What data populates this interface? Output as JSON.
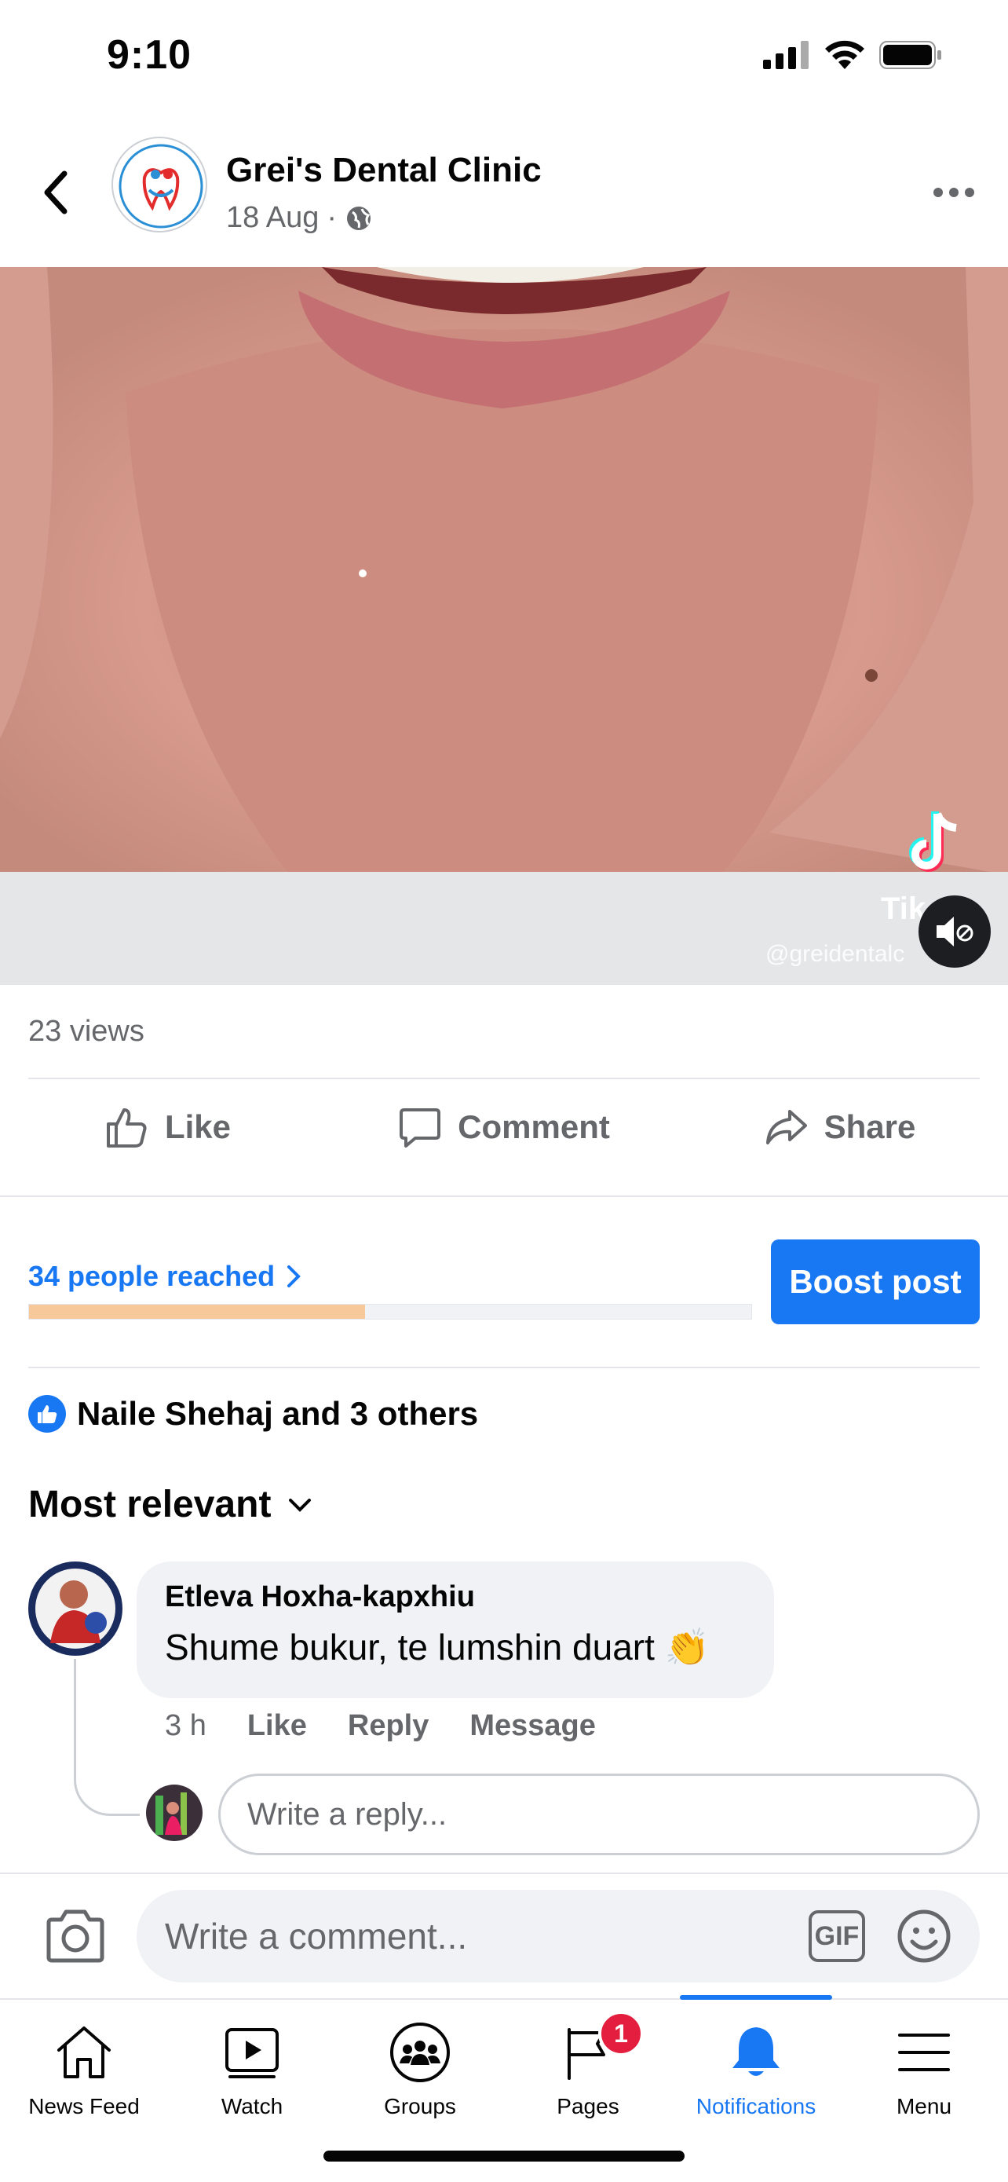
{
  "status_bar": {
    "time": "9:10"
  },
  "post": {
    "page_name": "Grei's Dental Clinic",
    "date": "18 Aug",
    "date_separator": "·",
    "video": {
      "watermark_text": "Tik",
      "watermark_handle": "@greidentalc"
    },
    "views": "23 views",
    "actions": {
      "like": "Like",
      "comment": "Comment",
      "share": "Share"
    },
    "reach": {
      "label": "34 people reached",
      "progress_percent": 46.5
    },
    "boost_label": "Boost post",
    "reactions_summary": "Naile Shehaj and 3 others"
  },
  "comments": {
    "sort_label": "Most relevant",
    "items": [
      {
        "author": "Etleva Hoxha-kapxhiu",
        "text": "Shume bukur, te lumshin duart 👏",
        "time": "3 h",
        "like": "Like",
        "reply": "Reply",
        "message": "Message"
      }
    ],
    "reply_placeholder": "Write a reply...",
    "comment_placeholder": "Write a comment...",
    "gif_label": "GIF"
  },
  "tabbar": {
    "tabs": [
      {
        "label": "News Feed",
        "icon": "home-icon"
      },
      {
        "label": "Watch",
        "icon": "watch-icon"
      },
      {
        "label": "Groups",
        "icon": "groups-icon"
      },
      {
        "label": "Pages",
        "icon": "pages-icon",
        "badge": "1"
      },
      {
        "label": "Notifications",
        "icon": "bell-icon",
        "active": true
      },
      {
        "label": "Menu",
        "icon": "menu-icon"
      }
    ]
  },
  "colors": {
    "accent": "#1877f2",
    "secondary_text": "#65676b",
    "reach_fill": "#f7c99a",
    "badge": "#e41e3f"
  }
}
